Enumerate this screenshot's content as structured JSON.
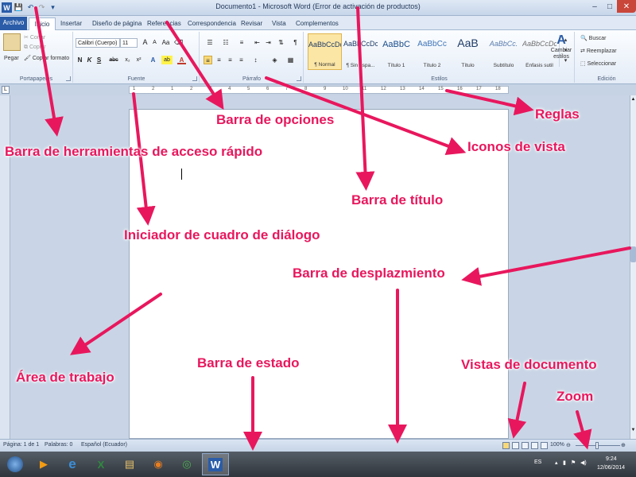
{
  "window": {
    "title": "Documento1 - Microsoft Word (Error de activación de productos)",
    "controls": [
      "–",
      "□",
      "✕"
    ]
  },
  "quick_access": [
    "save-icon",
    "undo-icon",
    "redo-icon",
    "customize-icon"
  ],
  "tabs": [
    "Archivo",
    "Inicio",
    "Insertar",
    "Diseño de página",
    "Referencias",
    "Correspondencia",
    "Revisar",
    "Vista",
    "Complementos"
  ],
  "ribbon": {
    "clipboard": {
      "label": "Portapapeles",
      "paste": "Pegar",
      "cut": "Cortar",
      "copy": "Copiar",
      "format_painter": "Copiar formato"
    },
    "font": {
      "label": "Fuente",
      "font_name": "Calibri (Cuerpo)",
      "font_size": "11",
      "buttons": [
        "N",
        "K",
        "S",
        "abc",
        "x₂",
        "x²",
        "A",
        "ab",
        "A"
      ]
    },
    "paragraph": {
      "label": "Párrafo"
    },
    "styles": {
      "label": "Estilos",
      "items": [
        {
          "sample": "AaBbCcDc",
          "name": "¶ Normal"
        },
        {
          "sample": "AaBbCcDc",
          "name": "¶ Sin espa..."
        },
        {
          "sample": "AaBbC",
          "name": "Título 1"
        },
        {
          "sample": "AaBbCc",
          "name": "Título 2"
        },
        {
          "sample": "AaB",
          "name": "Título"
        },
        {
          "sample": "AaBbCc.",
          "name": "Subtítulo"
        },
        {
          "sample": "AaBbCcDc",
          "name": "Énfasis sutil"
        }
      ],
      "change_styles": "Cambiar estilos"
    },
    "editing": {
      "label": "Edición",
      "find": "Buscar",
      "replace": "Reemplazar",
      "select": "Seleccionar"
    }
  },
  "ruler_numbers": [
    "1",
    "2",
    "1",
    "2",
    "3",
    "4",
    "5",
    "6",
    "7",
    "8",
    "9",
    "10",
    "11",
    "12",
    "13",
    "14",
    "15",
    "16",
    "17",
    "18"
  ],
  "status_bar": {
    "page": "Página: 1 de 1",
    "words": "Palabras: 0",
    "language": "Español (Ecuador)",
    "zoom": "100%"
  },
  "taskbar": {
    "language": "ES",
    "time": "9:24",
    "date": "12/06/2014",
    "apps": [
      "windows-start-icon",
      "media-player-icon",
      "internet-explorer-icon",
      "excel-icon",
      "file-explorer-icon",
      "firefox-icon",
      "chrome-icon",
      "word-icon"
    ]
  },
  "annotations": {
    "barra_opciones": "Barra de opciones",
    "reglas": "Reglas",
    "barra_herramientas": "Barra de herramientas de acceso rápido",
    "iconos_vista": "Iconos de vista",
    "barra_titulo": "Barra de título",
    "iniciador_dialogo": "Iniciador de cuadro de diálogo",
    "barra_desplazamiento": "Barra de desplazmiento",
    "area_trabajo": "Área de trabajo",
    "barra_estado": "Barra de estado",
    "vistas_documento": "Vistas de documento",
    "zoom": "Zoom"
  },
  "colors": {
    "annotation": "#e8175d",
    "word_blue": "#2a5ca8",
    "close_red": "#c9463b"
  }
}
